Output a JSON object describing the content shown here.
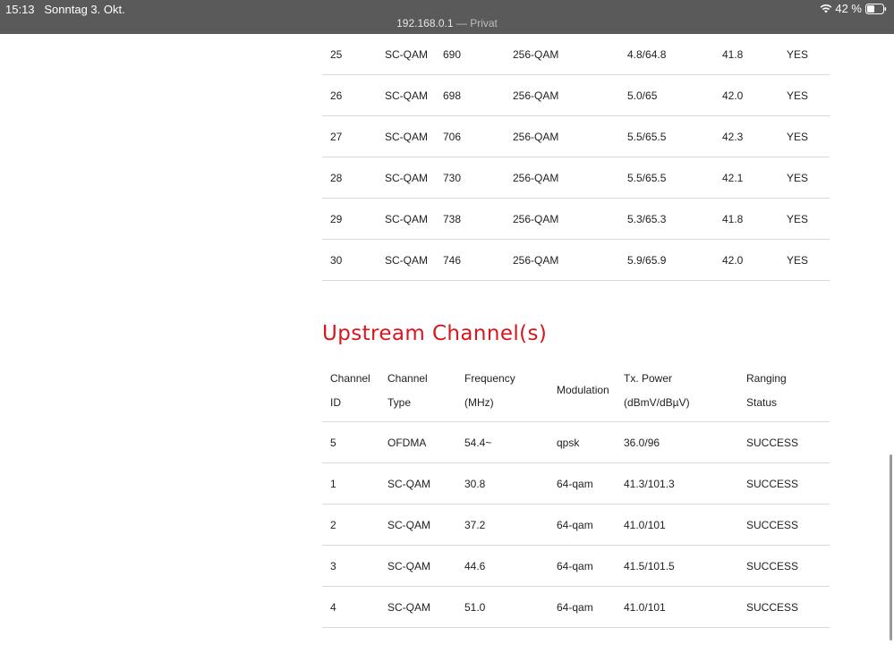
{
  "statusbar": {
    "time": "15:13",
    "date": "Sonntag 3. Okt.",
    "battery": "42 %",
    "wifi_icon": "wifi-icon",
    "battery_icon": "battery-icon"
  },
  "browser": {
    "url": "192.168.0.1",
    "mode": " — Privat"
  },
  "downstream": {
    "rows": [
      {
        "id": "25",
        "type": "SC-QAM",
        "freq": "690",
        "mod": "256-QAM",
        "power": "4.8/64.8",
        "snr": "41.8",
        "locked": "YES"
      },
      {
        "id": "26",
        "type": "SC-QAM",
        "freq": "698",
        "mod": "256-QAM",
        "power": "5.0/65",
        "snr": "42.0",
        "locked": "YES"
      },
      {
        "id": "27",
        "type": "SC-QAM",
        "freq": "706",
        "mod": "256-QAM",
        "power": "5.5/65.5",
        "snr": "42.3",
        "locked": "YES"
      },
      {
        "id": "28",
        "type": "SC-QAM",
        "freq": "730",
        "mod": "256-QAM",
        "power": "5.5/65.5",
        "snr": "42.1",
        "locked": "YES"
      },
      {
        "id": "29",
        "type": "SC-QAM",
        "freq": "738",
        "mod": "256-QAM",
        "power": "5.3/65.3",
        "snr": "41.8",
        "locked": "YES"
      },
      {
        "id": "30",
        "type": "SC-QAM",
        "freq": "746",
        "mod": "256-QAM",
        "power": "5.9/65.9",
        "snr": "42.0",
        "locked": "YES"
      }
    ]
  },
  "upstream": {
    "title": "Upstream Channel(s)",
    "headers": {
      "id_1": "Channel",
      "id_2": "ID",
      "type_1": "Channel",
      "type_2": "Type",
      "freq_1": "Frequency",
      "freq_2": "(MHz)",
      "mod": "Modulation",
      "power_1": "Tx. Power",
      "power_2": "(dBmV/dBµV)",
      "status_1": "Ranging",
      "status_2": "Status"
    },
    "rows": [
      {
        "id": "5",
        "type": "OFDMA",
        "freq": "54.4~",
        "mod": "qpsk",
        "power": "36.0/96",
        "status": "SUCCESS"
      },
      {
        "id": "1",
        "type": "SC-QAM",
        "freq": "30.8",
        "mod": "64-qam",
        "power": "41.3/101.3",
        "status": "SUCCESS"
      },
      {
        "id": "2",
        "type": "SC-QAM",
        "freq": "37.2",
        "mod": "64-qam",
        "power": "41.0/101",
        "status": "SUCCESS"
      },
      {
        "id": "3",
        "type": "SC-QAM",
        "freq": "44.6",
        "mod": "64-qam",
        "power": "41.5/101.5",
        "status": "SUCCESS"
      },
      {
        "id": "4",
        "type": "SC-QAM",
        "freq": "51.0",
        "mod": "64-qam",
        "power": "41.0/101",
        "status": "SUCCESS"
      }
    ]
  },
  "colors": {
    "accent": "#d8161e",
    "statusbar": "#5a5a5a"
  }
}
